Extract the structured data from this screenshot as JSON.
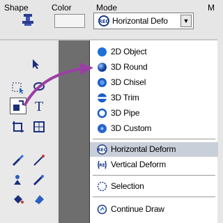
{
  "header": {
    "shape_label": "Shape",
    "color_label": "Color",
    "mode_label": "Mode",
    "extra_label": "M",
    "mode_value": "Horizontal Defo"
  },
  "menu": {
    "items": [
      {
        "label": "2D Object",
        "icon": "sphere-2d-icon"
      },
      {
        "label": "3D Round",
        "icon": "sphere-3d-round-icon"
      },
      {
        "label": "3D Chisel",
        "icon": "sphere-3d-chisel-icon"
      },
      {
        "label": "3D Trim",
        "icon": "sphere-3d-trim-icon"
      },
      {
        "label": "3D Pipe",
        "icon": "ring-3d-pipe-icon"
      },
      {
        "label": "3D Custom",
        "icon": "sphere-3d-custom-icon"
      },
      {
        "label": "Horizontal Deform",
        "icon": "horizontal-deform-icon"
      },
      {
        "label": "Vertical Deform",
        "icon": "vertical-deform-icon"
      },
      {
        "label": "Selection",
        "icon": "selection-icon"
      },
      {
        "label": "Continue Draw",
        "icon": "continue-draw-icon"
      }
    ]
  },
  "colors": {
    "accent_arrow": "#9b3fa6",
    "highlight": "#c9cfd8",
    "dark_panel": "#6e6e6e",
    "sphere_blue": "#1e6fd6"
  }
}
